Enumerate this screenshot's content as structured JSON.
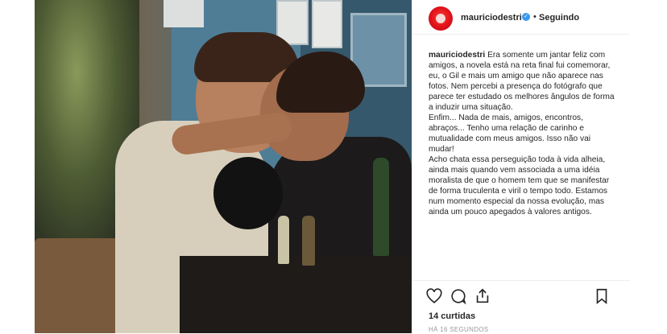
{
  "post": {
    "username": "mauriciodestri",
    "verified_glyph": "✓",
    "separator": "•",
    "follow_label": "Seguindo",
    "caption": {
      "user": "mauriciodestri",
      "paragraph1": "Era somente um jantar feliz com amigos, a novela está na reta final fui comemorar, eu, o Gil e mais um amigo que não aparece nas fotos. Nem percebi a presença do fotógrafo que parece ter estudado os melhores ângulos de forma a induzir uma situação.",
      "paragraph2": "Enfim... Nada de mais, amigos, encontros, abraços... Tenho uma relação de carinho e mutualidade com meus amigos. Isso não vai mudar!",
      "paragraph3": "Acho chata essa perseguição toda à vida alheia, ainda mais quando vem associada a uma idéia moralista de que o homem tem que se manifestar de forma truculenta e viril o tempo todo. Estamos num momento especial da nossa evolução, mas ainda um pouco apegados à valores antigos."
    },
    "likes": "14 curtidas",
    "timestamp": "HÁ 16 SEGUNDOS"
  },
  "icons": {
    "avatar": "red-circle-avatar",
    "verified": "verified-badge-icon",
    "like": "heart-icon",
    "comment": "comment-icon",
    "share": "share-icon",
    "save": "bookmark-icon"
  },
  "colors": {
    "accent_blue": "#3897f0",
    "avatar_red": "#e0121a",
    "text": "#262626",
    "muted": "#999999"
  }
}
